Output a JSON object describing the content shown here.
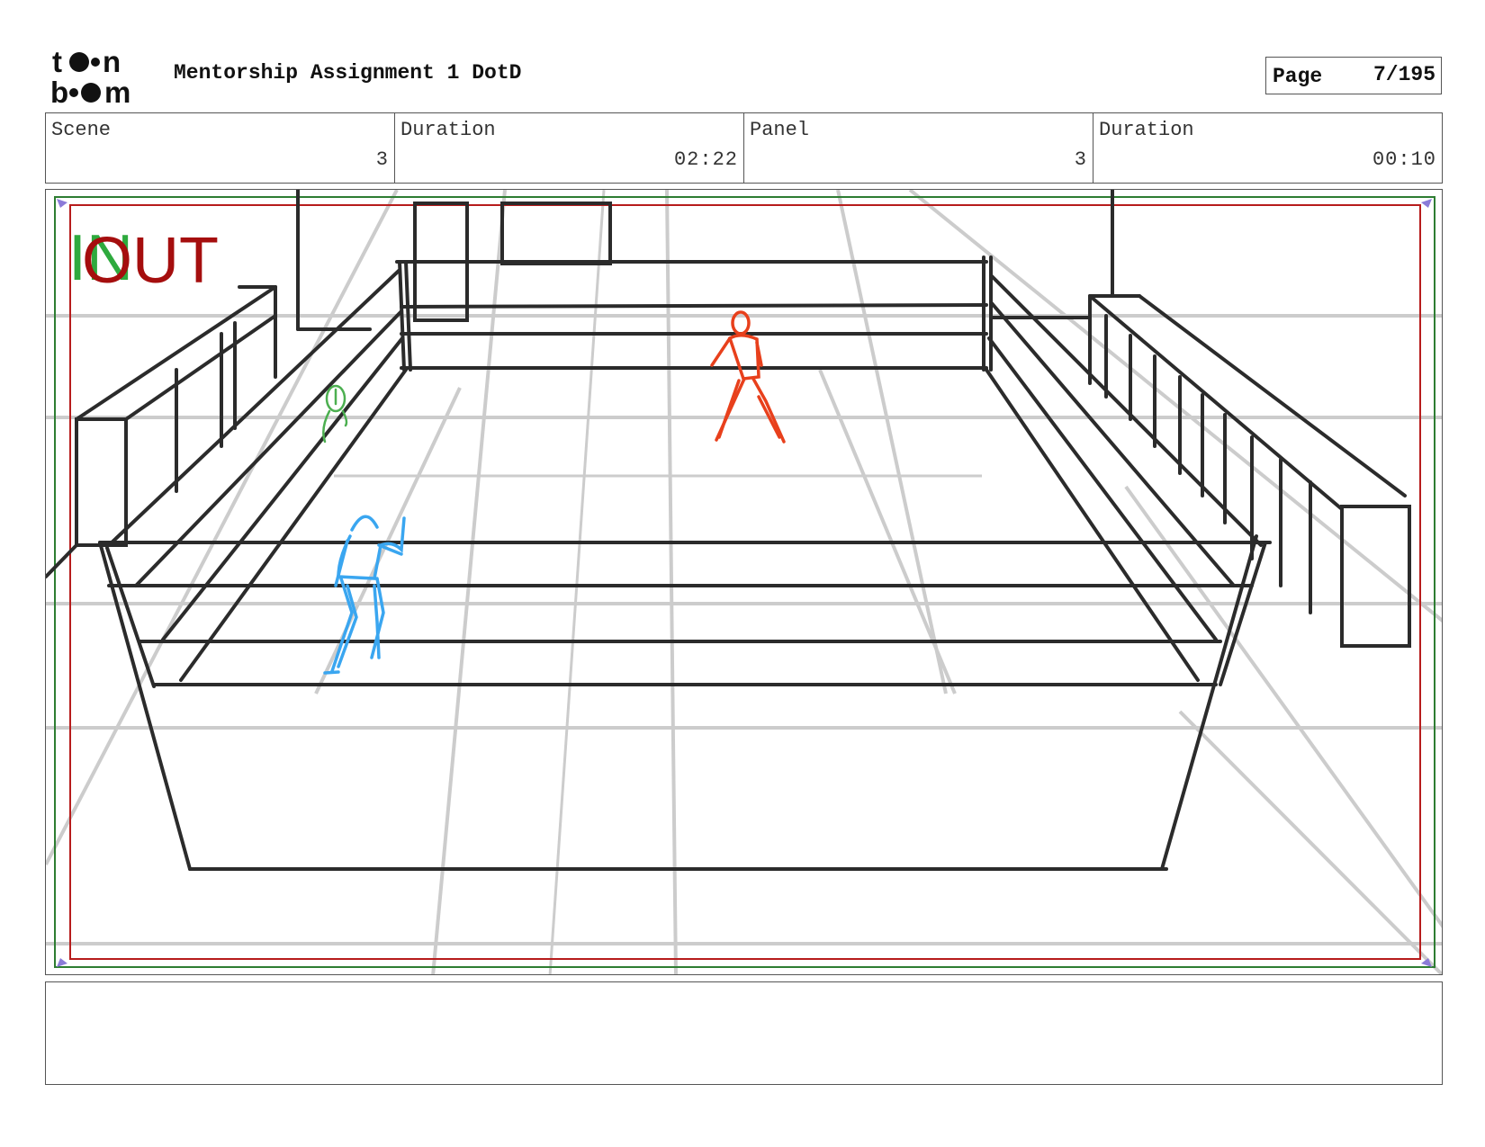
{
  "header": {
    "logo_text": "toon boom",
    "project_title": "Mentorship Assignment 1 DotD",
    "page_label": "Page",
    "page_value": "7/195"
  },
  "info": [
    {
      "label": "Scene",
      "value": "3"
    },
    {
      "label": "Duration",
      "value": "02:22"
    },
    {
      "label": "Panel",
      "value": "3"
    },
    {
      "label": "Duration",
      "value": "00:10"
    }
  ],
  "panel": {
    "in_label": "IN",
    "out_label": "OUT"
  },
  "notes": {
    "text": ""
  },
  "colors": {
    "frame_green": "#2e7d32",
    "frame_red": "#b71c1c",
    "sketch_dark": "#2b2b2b",
    "guide_gray": "#cccccc",
    "figure_blue": "#3aa6f0",
    "figure_red": "#e8401c",
    "figure_green": "#4caf50"
  }
}
